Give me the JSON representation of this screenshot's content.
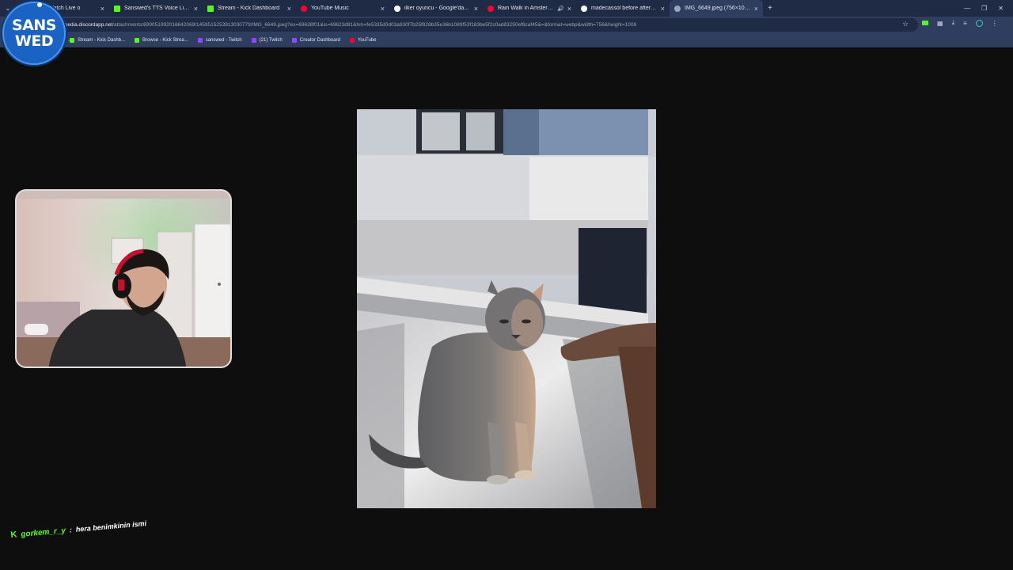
{
  "browser": {
    "tabs": [
      {
        "title": "ream - Watch Live o",
        "favicon": "kick-icon",
        "active": false
      },
      {
        "title": "Sanswed's TTS Voice List | Kick",
        "favicon": "kick-icon",
        "active": false
      },
      {
        "title": "Stream - Kick Dashboard",
        "favicon": "kick-icon",
        "active": false
      },
      {
        "title": "YouTube Music",
        "favicon": "youtube-music-icon",
        "active": false
      },
      {
        "title": "ilker oyuncu - Google'da Ara",
        "favicon": "google-icon",
        "active": false
      },
      {
        "title": "Rain Walk in Amsterdam-4K",
        "favicon": "youtube-icon",
        "active": false,
        "audio": true
      },
      {
        "title": "madecassol before after - Goog",
        "favicon": "google-icon",
        "active": false
      },
      {
        "title": "IMG_6649.jpeg (756×1008)",
        "favicon": "image-file-icon",
        "active": true
      }
    ],
    "address": {
      "host": "media.discordapp.net",
      "rest": "/attachments/899051992016642069/1459515253913030779/IMG_6649.jpeg?ex=69638f01&is=69623d81&hm=fe5335d0d03a930f7b25f828b35e36b1089f53f183be5f2c0ad83250ef8caf45&=&format=webp&width=756&height=1008"
    },
    "bookmarks": [
      {
        "label": "Stream - Kick Dashb...",
        "favicon": "kick-icon"
      },
      {
        "label": "Browse - Kick Strea...",
        "favicon": "kick-icon"
      },
      {
        "label": "sanswed - Twitch",
        "favicon": "twitch-icon"
      },
      {
        "label": "(21) Twitch",
        "favicon": "twitch-icon"
      },
      {
        "label": "Creator Dashboard",
        "favicon": "twitch-icon"
      },
      {
        "label": "YouTube",
        "favicon": "youtube-icon"
      }
    ],
    "bookmark_prefix": "...",
    "new_tab_glyph": "+",
    "close_glyph": "×"
  },
  "overlay": {
    "logo_line1": "SANS",
    "logo_line2": "WED",
    "chat": {
      "platform_badge": "K",
      "username": "gorkem_r_y",
      "separator": ":",
      "message": "hera benimkinin ismi"
    }
  },
  "colors": {
    "tabstrip": "#1f2a44",
    "toolbar": "#2f3d5e",
    "page_bg": "#0e0e0e",
    "kick_green": "#53fc18",
    "logo_blue": "#1a63c4"
  }
}
